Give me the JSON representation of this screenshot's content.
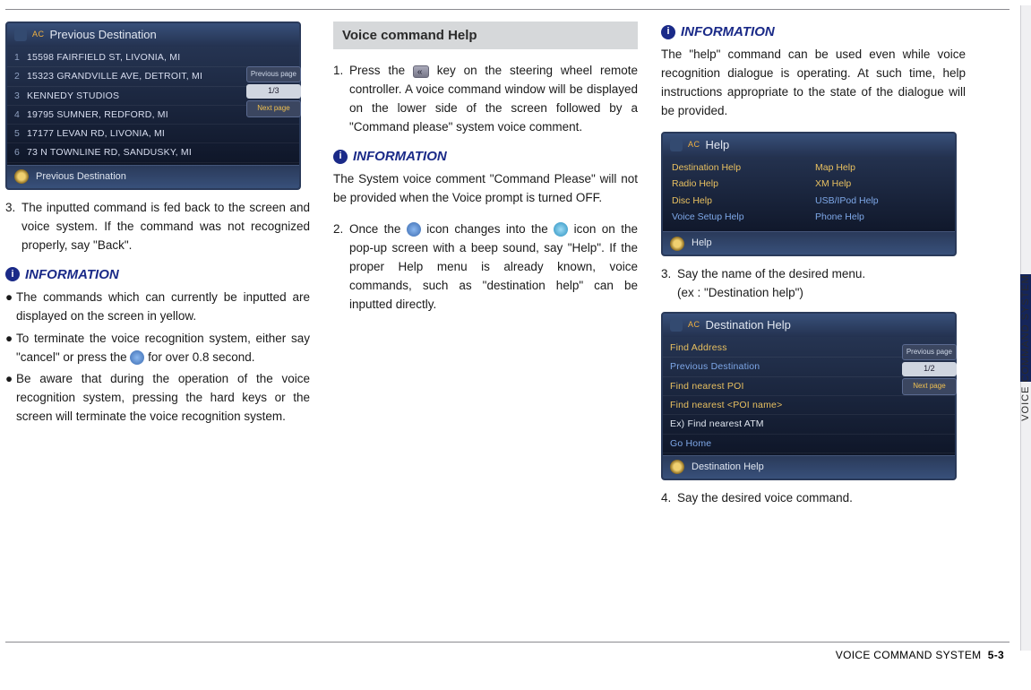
{
  "page": {
    "section_label": "VOICE COMMAND SYSTEM",
    "footer_section": "VOICE COMMAND SYSTEM",
    "page_number": "5-3"
  },
  "prev_dest_screen": {
    "title": "Previous Destination",
    "ac": "AC",
    "rows": [
      {
        "n": "1",
        "t": "15598 FAIRFIELD ST, LIVONIA, MI"
      },
      {
        "n": "2",
        "t": "15323 GRANDVILLE AVE, DETROIT, MI"
      },
      {
        "n": "3",
        "t": "KENNEDY STUDIOS"
      },
      {
        "n": "4",
        "t": "19795 SUMNER, REDFORD, MI"
      },
      {
        "n": "5",
        "t": "17177 LEVAN RD, LIVONIA, MI"
      },
      {
        "n": "6",
        "t": "73 N TOWNLINE RD, SANDUSKY, MI"
      }
    ],
    "prev_page": "Previous page",
    "indicator": "1/3",
    "next_page": "Next page",
    "footer": "Previous Destination"
  },
  "col1": {
    "step3": "The inputted command is fed back to the screen and voice system. If the command was not recognized properly, say \"Back\".",
    "info_head": "INFORMATION",
    "b1": "The commands which can currently be inputted are displayed on the screen in yellow.",
    "b2a": "To terminate the voice recognition system, either say \"cancel\" or press the ",
    "b2b": " for over 0.8  second.",
    "b3": "Be aware that during the operation of the voice recognition system, pressing the hard keys or the screen will terminate the voice recognition system."
  },
  "col2": {
    "section": "Voice command Help",
    "s1a": "Press the ",
    "s1b": " key on the steering wheel remote controller. A voice command window will be displayed on the lower side of the screen followed by a \"Command please\" system voice comment.",
    "info_head": "INFORMATION",
    "info_body": "The System voice comment \"Command Please\" will not be provided when the Voice prompt is turned OFF.",
    "s2a": "Once the ",
    "s2b": " icon changes into the ",
    "s2c": " icon on the pop-up screen with a beep sound, say \"Help\". If the proper Help menu is already known, voice commands, such as \"destination help\" can be inputted directly."
  },
  "col3": {
    "info_head": "INFORMATION",
    "info_body": "The \"help\" command can be used even while voice recognition dialogue is operating. At such time, help instructions appropriate to the state of the dialogue will be provided.",
    "step3": "Say the name of the desired menu.",
    "step3_ex": "(ex : \"Destination help\")",
    "step4": "Say the desired voice command."
  },
  "help_screen": {
    "title": "Help",
    "ac": "AC",
    "left": [
      "Destination Help",
      "Radio Help",
      "Disc Help",
      "Voice Setup Help"
    ],
    "right": [
      "Map Help",
      "XM Help",
      "USB/IPod Help",
      "Phone Help"
    ],
    "footer": "Help"
  },
  "dest_help_screen": {
    "title": "Destination Help",
    "ac": "AC",
    "rows": [
      {
        "t": "Find Address",
        "c": "y"
      },
      {
        "t": "Previous Destination",
        "c": "b"
      },
      {
        "t": "Find nearest POI",
        "c": "y"
      },
      {
        "t": "Find nearest <POI name>",
        "c": "y"
      },
      {
        "t": "   Ex) Find nearest ATM",
        "c": "w"
      },
      {
        "t": "Go Home",
        "c": "b"
      }
    ],
    "prev_page": "Previous page",
    "indicator": "1/2",
    "next_page": "Next page",
    "footer": "Destination Help"
  }
}
